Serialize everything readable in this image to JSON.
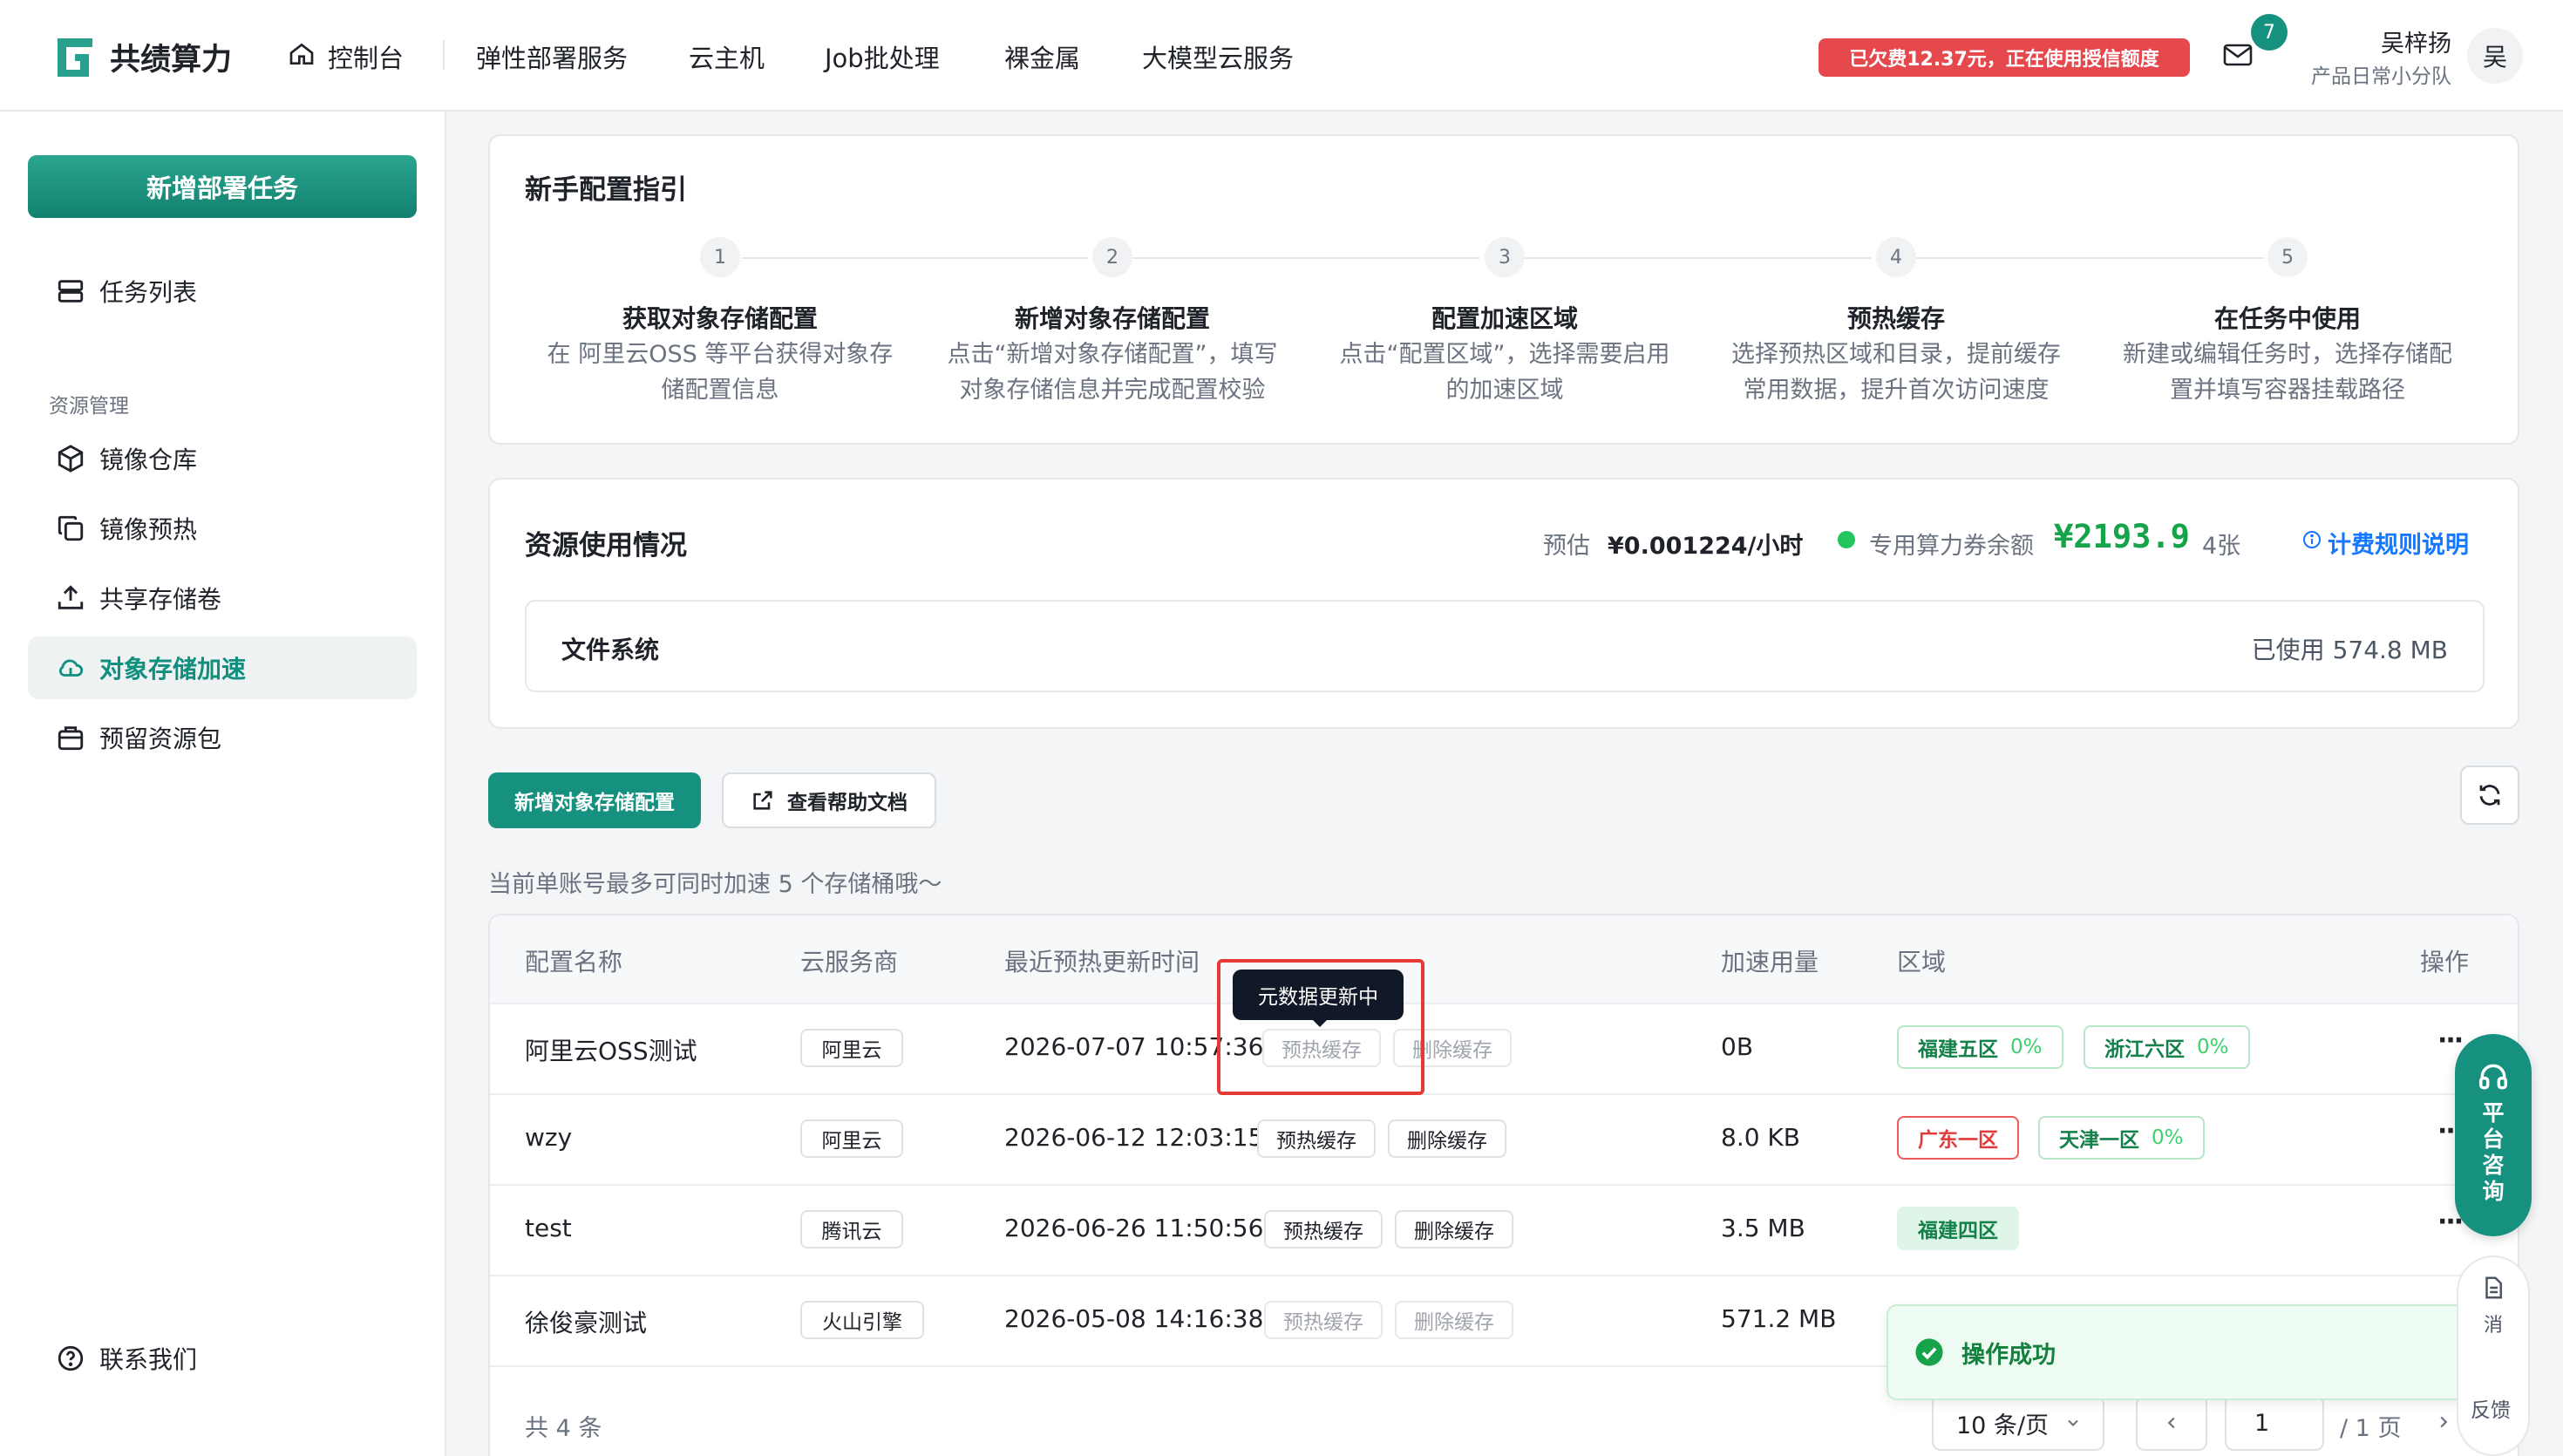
{
  "brand": {
    "name": "共绩算力"
  },
  "nav": {
    "items": [
      "控制台",
      "弹性部署服务",
      "云主机",
      "Job批处理",
      "裸金属",
      "大模型云服务"
    ]
  },
  "header": {
    "debt_notice": "已欠费12.37元，正在使用授信额度",
    "mail_badge": "7",
    "user_name": "吴梓扬",
    "team_name": "产品日常小分队",
    "avatar_initial": "吴"
  },
  "sidebar": {
    "new_task_button": "新增部署任务",
    "task_list": "任务列表",
    "section_title": "资源管理",
    "items": [
      "镜像仓库",
      "镜像预热",
      "共享存储卷",
      "对象存储加速",
      "预留资源包"
    ],
    "active_item": "对象存储加速",
    "contact": "联系我们"
  },
  "guide": {
    "title": "新手配置指引",
    "steps": [
      {
        "num": "1",
        "title": "获取对象存储配置",
        "desc1": "在 阿里云OSS 等平台获得对象存",
        "desc2": "储配置信息"
      },
      {
        "num": "2",
        "title": "新增对象存储配置",
        "desc1": "点击“新增对象存储配置”，填写",
        "desc2": "对象存储信息并完成配置校验"
      },
      {
        "num": "3",
        "title": "配置加速区域",
        "desc1": "点击“配置区域”，选择需要启用",
        "desc2": "的加速区域"
      },
      {
        "num": "4",
        "title": "预热缓存",
        "desc1": "选择预热区域和目录，提前缓存",
        "desc2": "常用数据，提升首次访问速度"
      },
      {
        "num": "5",
        "title": "在任务中使用",
        "desc1": "新建或编辑任务时，选择存储配",
        "desc2": "置并填写容器挂载路径"
      }
    ]
  },
  "usage": {
    "title": "资源使用情况",
    "estimate_label": "预估",
    "estimate_value": "¥0.001224/小时",
    "voucher_label": "专用算力券余额",
    "voucher_value": "¥2193.9",
    "voucher_count": "4张",
    "billing_link": "计费规则说明",
    "fs_label": "文件系统",
    "fs_used": "已使用 574.8 MB"
  },
  "toolbar": {
    "add_button": "新增对象存储配置",
    "help_button": "查看帮助文档",
    "limit_notice": "当前单账号最多可同时加速 5 个存储桶哦～"
  },
  "table": {
    "headers": [
      "配置名称",
      "云服务商",
      "最近预热更新时间",
      "加速用量",
      "区域",
      "操作"
    ],
    "rows": [
      {
        "name": "阿里云OSS测试",
        "provider": "阿里云",
        "time": "2026-07-07 10:57:36",
        "usage": "0B",
        "prewarm": "预热缓存",
        "delete": "删除缓存",
        "disabled": true,
        "regions": [
          {
            "name": "福建五区",
            "pct": "0%",
            "style": "green"
          },
          {
            "name": "浙江六区",
            "pct": "0%",
            "style": "green"
          }
        ]
      },
      {
        "name": "wzy",
        "provider": "阿里云",
        "time": "2026-06-12 12:03:15",
        "usage": "8.0 KB",
        "prewarm": "预热缓存",
        "delete": "删除缓存",
        "disabled": false,
        "regions": [
          {
            "name": "广东一区",
            "pct": "",
            "style": "red"
          },
          {
            "name": "天津一区",
            "pct": "0%",
            "style": "green"
          }
        ]
      },
      {
        "name": "test",
        "provider": "腾讯云",
        "time": "2026-06-26 11:50:56",
        "usage": "3.5 MB",
        "prewarm": "预热缓存",
        "delete": "删除缓存",
        "disabled": false,
        "regions": [
          {
            "name": "福建四区",
            "pct": "",
            "style": "fill"
          }
        ]
      },
      {
        "name": "徐俊豪测试",
        "provider": "火山引擎",
        "time": "2026-05-08 14:16:38",
        "usage": "571.2 MB",
        "prewarm": "预热缓存",
        "delete": "删除缓存",
        "disabled": true,
        "regions": []
      }
    ],
    "tooltip": "元数据更新中"
  },
  "pagination": {
    "total": "共 4 条",
    "page_size": "10 条/页",
    "current_page": "1",
    "total_pages": "/ 1 页"
  },
  "toast": {
    "message": "操作成功"
  },
  "float": {
    "consult_chars": [
      "平",
      "台",
      "咨",
      "询"
    ],
    "doc_char": "消",
    "feedback": "反馈"
  },
  "colors": {
    "brand": "#17917f",
    "danger": "#e5484d",
    "success": "#22c55e",
    "link": "#1677ff"
  }
}
